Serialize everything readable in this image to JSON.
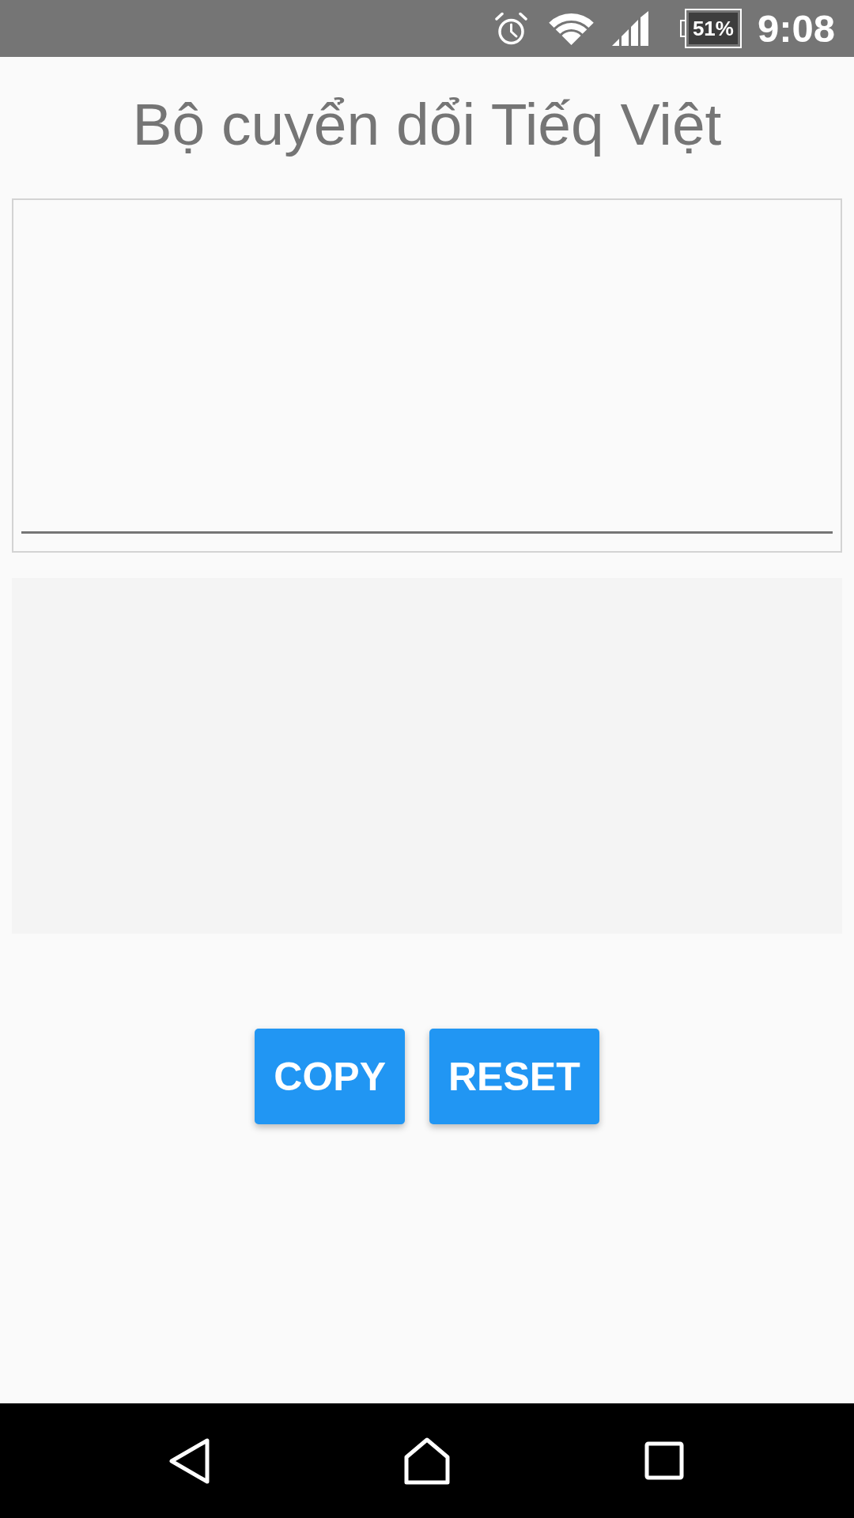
{
  "status_bar": {
    "battery": "51%",
    "time": "9:08"
  },
  "title": "Bộ cuyển dổi Tiếq Việt",
  "buttons": [
    {
      "label": "COPY"
    },
    {
      "label": "RESET"
    }
  ]
}
